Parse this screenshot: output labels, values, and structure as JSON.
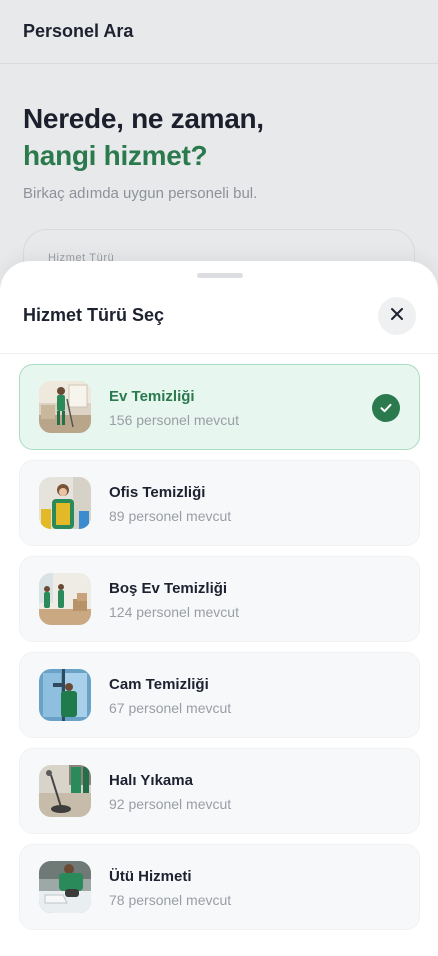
{
  "background": {
    "header_title": "Personel Ara",
    "headline_line1": "Nerede, ne zaman,",
    "headline_line2": "hangi hizmet?",
    "subtitle": "Birkaç adımda uygun personeli bul.",
    "field_label": "Hizmet Türü"
  },
  "sheet": {
    "title": "Hizmet Türü Seç",
    "close_icon": "close-icon",
    "selected_index": 0,
    "items": [
      {
        "name": "Ev Temizliği",
        "count": "156 personel mevcut",
        "icon": "cleaner-home-photo"
      },
      {
        "name": "Ofis Temizliği",
        "count": "89 personel mevcut",
        "icon": "cleaner-office-photo"
      },
      {
        "name": "Boş Ev Temizliği",
        "count": "124 personel mevcut",
        "icon": "cleaner-empty-home-photo"
      },
      {
        "name": "Cam Temizliği",
        "count": "67 personel mevcut",
        "icon": "window-cleaning-photo"
      },
      {
        "name": "Halı Yıkama",
        "count": "92 personel mevcut",
        "icon": "carpet-cleaning-photo"
      },
      {
        "name": "Ütü Hizmeti",
        "count": "78 personel mevcut",
        "icon": "ironing-photo"
      }
    ]
  },
  "colors": {
    "accent": "#2a7a4e",
    "selected_bg": "#e7f6ee",
    "selected_border": "#a9dcc0",
    "item_bg": "#f7f8fa",
    "muted_text": "#9a9da5"
  }
}
